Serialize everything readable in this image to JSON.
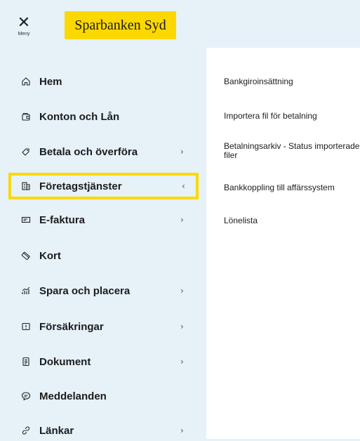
{
  "header": {
    "menu_label": "Meny",
    "brand": "Sparbanken Syd",
    "brand_color": "#fbd800"
  },
  "sidebar": {
    "items": [
      {
        "label": "Hem",
        "icon": "home-icon",
        "chevron": false
      },
      {
        "label": "Konton och Lån",
        "icon": "wallet-icon",
        "chevron": false
      },
      {
        "label": "Betala och överföra",
        "icon": "tag-icon",
        "chevron": true
      },
      {
        "label": "Företagstjänster",
        "icon": "building-icon",
        "chevron": true,
        "active": true
      },
      {
        "label": "E-faktura",
        "icon": "invoice-icon",
        "chevron": true
      },
      {
        "label": "Kort",
        "icon": "card-icon",
        "chevron": false
      },
      {
        "label": "Spara och placera",
        "icon": "chart-icon",
        "chevron": true
      },
      {
        "label": "Försäkringar",
        "icon": "shield-icon",
        "chevron": true
      },
      {
        "label": "Dokument",
        "icon": "document-icon",
        "chevron": true
      },
      {
        "label": "Meddelanden",
        "icon": "chat-icon",
        "chevron": false
      },
      {
        "label": "Länkar",
        "icon": "link-icon",
        "chevron": true
      }
    ]
  },
  "submenu": {
    "items": [
      "Bankgiroinsättning",
      "Importera fil för betalning",
      "Betalningsarkiv - Status importerade filer",
      "Bankkoppling till affärssystem",
      "Lönelista"
    ]
  }
}
